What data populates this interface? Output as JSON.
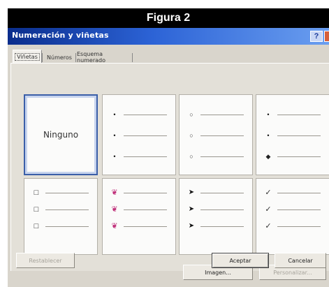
{
  "figure": {
    "caption": "Figura 2"
  },
  "dialog": {
    "title": "Numeración y viñetas",
    "help_label": "?",
    "tabs": [
      {
        "label": "Viñetas"
      },
      {
        "label": "Números"
      },
      {
        "label": "Esquema numerado"
      }
    ],
    "gallery": {
      "none_label": "Ninguno",
      "bullets": {
        "filled_dot": "•",
        "hollow_dot": "○",
        "diamond": "◆",
        "square": "□",
        "pink_pointer": "❦",
        "arrow": "➤",
        "check": "✓"
      }
    },
    "buttons": {
      "image": "Imagen...",
      "customize": "Personalizar...",
      "reset": "Restablecer",
      "accept": "Aceptar",
      "cancel": "Cancelar"
    },
    "colors": {
      "title_bar": "#0a2d8c",
      "pink_bullet": "#c0307a",
      "selection": "#3b5fa8"
    }
  }
}
